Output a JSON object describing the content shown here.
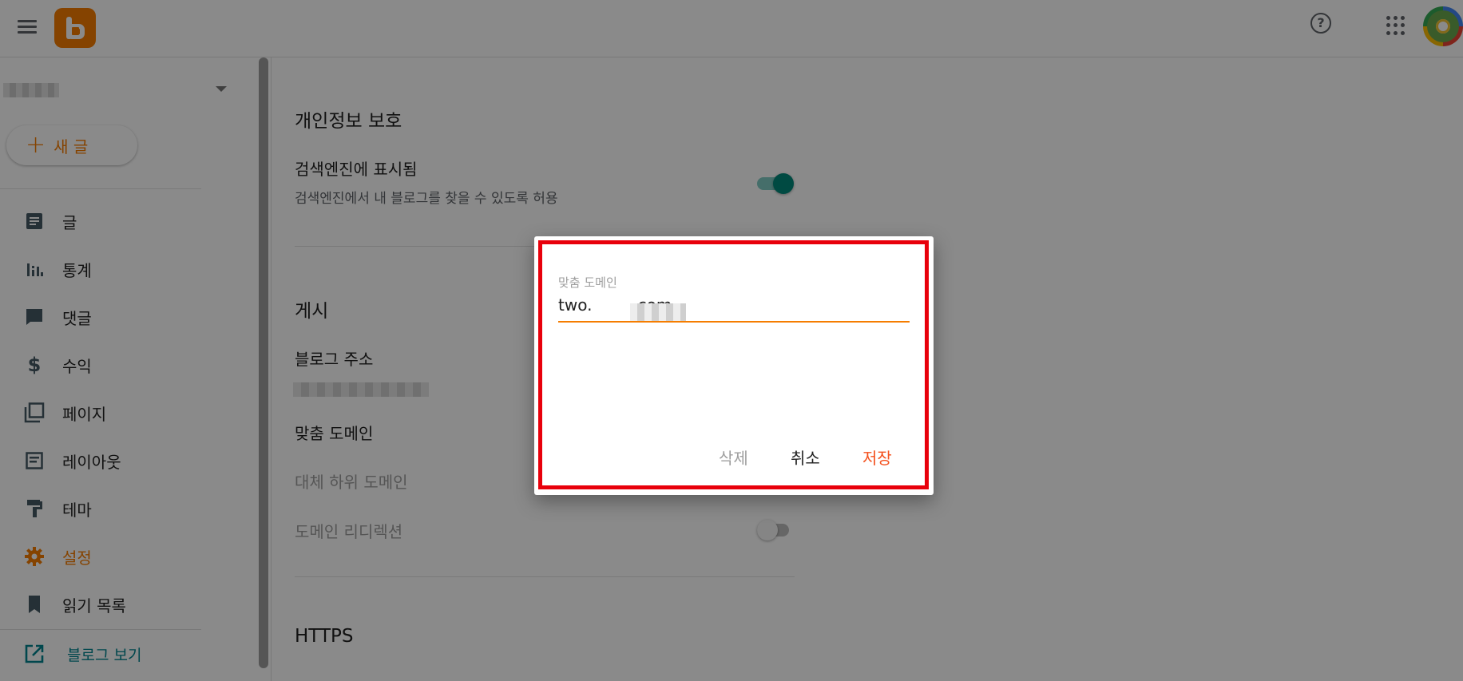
{
  "header": {
    "menu_icon": "hamburger-icon",
    "logo_icon": "blogger-logo-icon",
    "help_icon": "help-icon",
    "apps_icon": "apps-grid-icon",
    "brand_color": "#f57d00"
  },
  "sidebar": {
    "new_post_plus": "+",
    "new_post_label": "새 글",
    "items": [
      {
        "label": "글",
        "icon": "posts-icon"
      },
      {
        "label": "통계",
        "icon": "stats-icon"
      },
      {
        "label": "댓글",
        "icon": "comments-icon"
      },
      {
        "label": "수익",
        "icon": "dollar-icon"
      },
      {
        "label": "페이지",
        "icon": "pages-icon"
      },
      {
        "label": "레이아웃",
        "icon": "layout-icon"
      },
      {
        "label": "테마",
        "icon": "theme-icon"
      },
      {
        "label": "설정",
        "icon": "gear-icon",
        "active": true
      },
      {
        "label": "읽기 목록",
        "icon": "bookmark-icon"
      }
    ],
    "view_blog_label": "블로그 보기"
  },
  "main": {
    "privacy": {
      "title": "개인정보 보호",
      "search_visible_title": "검색엔진에 표시됨",
      "search_visible_sub": "검색엔진에서 내 블로그를 찾을 수 있도록 허용",
      "search_visible_on": true
    },
    "publishing": {
      "title": "게시",
      "blog_address_title": "블로그 주소",
      "custom_domain_title": "맞춤 도메인",
      "fallback_subdomain": "대체 하위 도메인",
      "domain_redirect": "도메인 리디렉션",
      "domain_redirect_on": false
    },
    "https": {
      "title": "HTTPS"
    }
  },
  "dialog": {
    "field_label": "맞춤 도메인",
    "field_value": "two.        .com",
    "delete_label": "삭제",
    "cancel_label": "취소",
    "save_label": "저장",
    "highlight_color": "#e8000b",
    "accent_color": "#f4511e"
  }
}
